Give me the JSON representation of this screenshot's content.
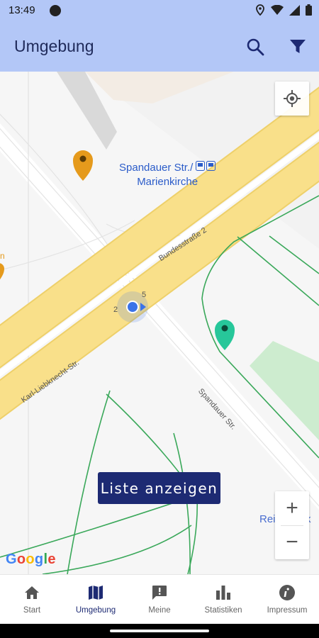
{
  "status_bar": {
    "time": "13:49"
  },
  "app_bar": {
    "title": "Umgebung",
    "search_icon": "search-icon",
    "filter_icon": "filter-icon"
  },
  "map": {
    "street_labels": {
      "bundesstrasse": "Bundesstraße 2",
      "liebknecht": "Karl-Liebknecht-Str.",
      "spandauer": "Spandauer Str.",
      "route_2": "2",
      "route_5": "5"
    },
    "poi": {
      "line1": "Spandauer Str./",
      "line2": "Marienkirche"
    },
    "reisebank": "ReiseBank",
    "partial_label": "n",
    "list_button": "Liste anzeigen",
    "zoom_in": "+",
    "zoom_out": "−",
    "google_logo": {
      "g1": "G",
      "o1": "o",
      "o2": "o",
      "g2": "g",
      "l": "l",
      "e": "e"
    },
    "colors": {
      "road": "#f9e08a",
      "road_edge": "#eed06a",
      "green_line": "#3aa85a",
      "park": "#cdeccf",
      "pin_orange": "#e59a1c",
      "pin_teal": "#27c79a",
      "location": "#3b73e8"
    }
  },
  "bottom_nav": {
    "items": [
      {
        "label": "Start",
        "icon": "home-icon"
      },
      {
        "label": "Umgebung",
        "icon": "map-icon"
      },
      {
        "label": "Meine",
        "icon": "feedback-icon"
      },
      {
        "label": "Statistiken",
        "icon": "bar-chart-icon"
      },
      {
        "label": "Impressum",
        "icon": "info-icon"
      }
    ],
    "active_index": 1
  }
}
